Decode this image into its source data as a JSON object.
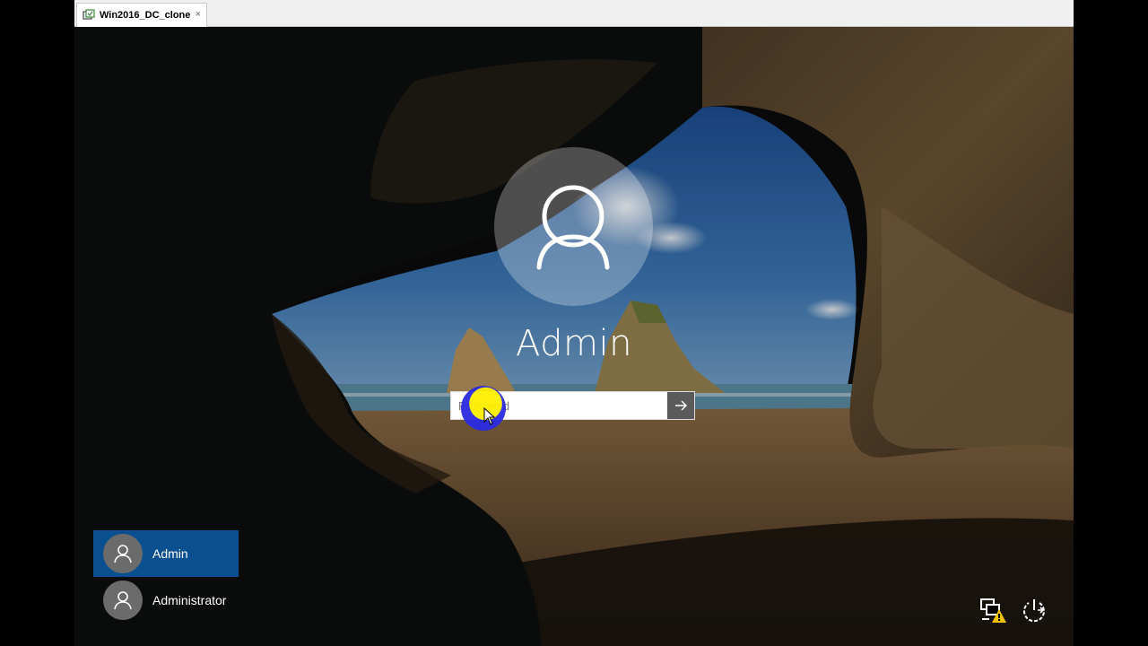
{
  "window": {
    "tab_title": "Win2016_DC_clone",
    "tab_close": "×"
  },
  "login": {
    "username": "Admin",
    "password_placeholder": "Password",
    "submit_icon": "arrow-right-icon"
  },
  "users": [
    {
      "name": "Admin",
      "selected": true
    },
    {
      "name": "Administrator",
      "selected": false
    }
  ],
  "system_icons": [
    "network-warning-icon",
    "power-icon"
  ],
  "colors": {
    "selected_user_bg": "#0a4f8f",
    "submit_bg": "#5a5a5a",
    "cursor_highlight": "#f4ea12"
  }
}
